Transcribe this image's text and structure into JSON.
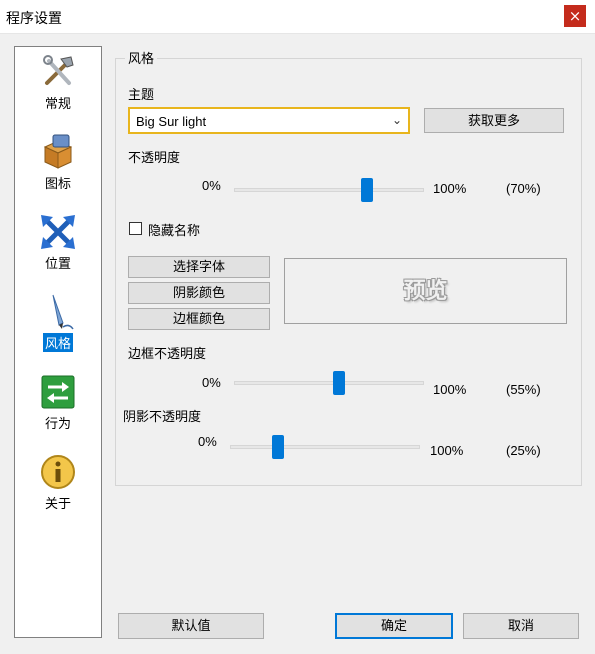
{
  "window": {
    "title": "程序设置",
    "close_glyph": "×"
  },
  "sidebar": {
    "items": [
      {
        "label": "常规",
        "icon": "tools-icon",
        "active": false
      },
      {
        "label": "图标",
        "icon": "package-icon",
        "active": false
      },
      {
        "label": "位置",
        "icon": "move-arrows-icon",
        "active": false
      },
      {
        "label": "风格",
        "icon": "pen-style-icon",
        "active": true
      },
      {
        "label": "行为",
        "icon": "exchange-arrows-icon",
        "active": false
      },
      {
        "label": "关于",
        "icon": "info-icon",
        "active": false
      }
    ]
  },
  "style_group": {
    "legend": "风格",
    "theme_label": "主题",
    "theme_value": "Big Sur light",
    "get_more_label": "获取更多",
    "opacity": {
      "label": "不透明度",
      "min_label": "0%",
      "max_label": "100%",
      "value_label": "(70%)",
      "value": 70
    },
    "hide_name_label": "隐藏名称",
    "hide_name_checked": false,
    "font_button": "选择字体",
    "shadow_color_button": "阴影颜色",
    "border_color_button": "边框颜色",
    "preview_text": "预览",
    "border_opacity": {
      "label": "边框不透明度",
      "min_label": "0%",
      "max_label": "100%",
      "value_label": "(55%)",
      "value": 55
    },
    "shadow_opacity": {
      "label": "阴影不透明度",
      "min_label": "0%",
      "max_label": "100%",
      "value_label": "(25%)",
      "value": 25
    }
  },
  "footer": {
    "default_label": "默认值",
    "ok_label": "确定",
    "cancel_label": "取消"
  },
  "colors": {
    "accent": "#0078d7",
    "focus_border": "#e8b51d",
    "close_bg": "#c42b1c"
  }
}
